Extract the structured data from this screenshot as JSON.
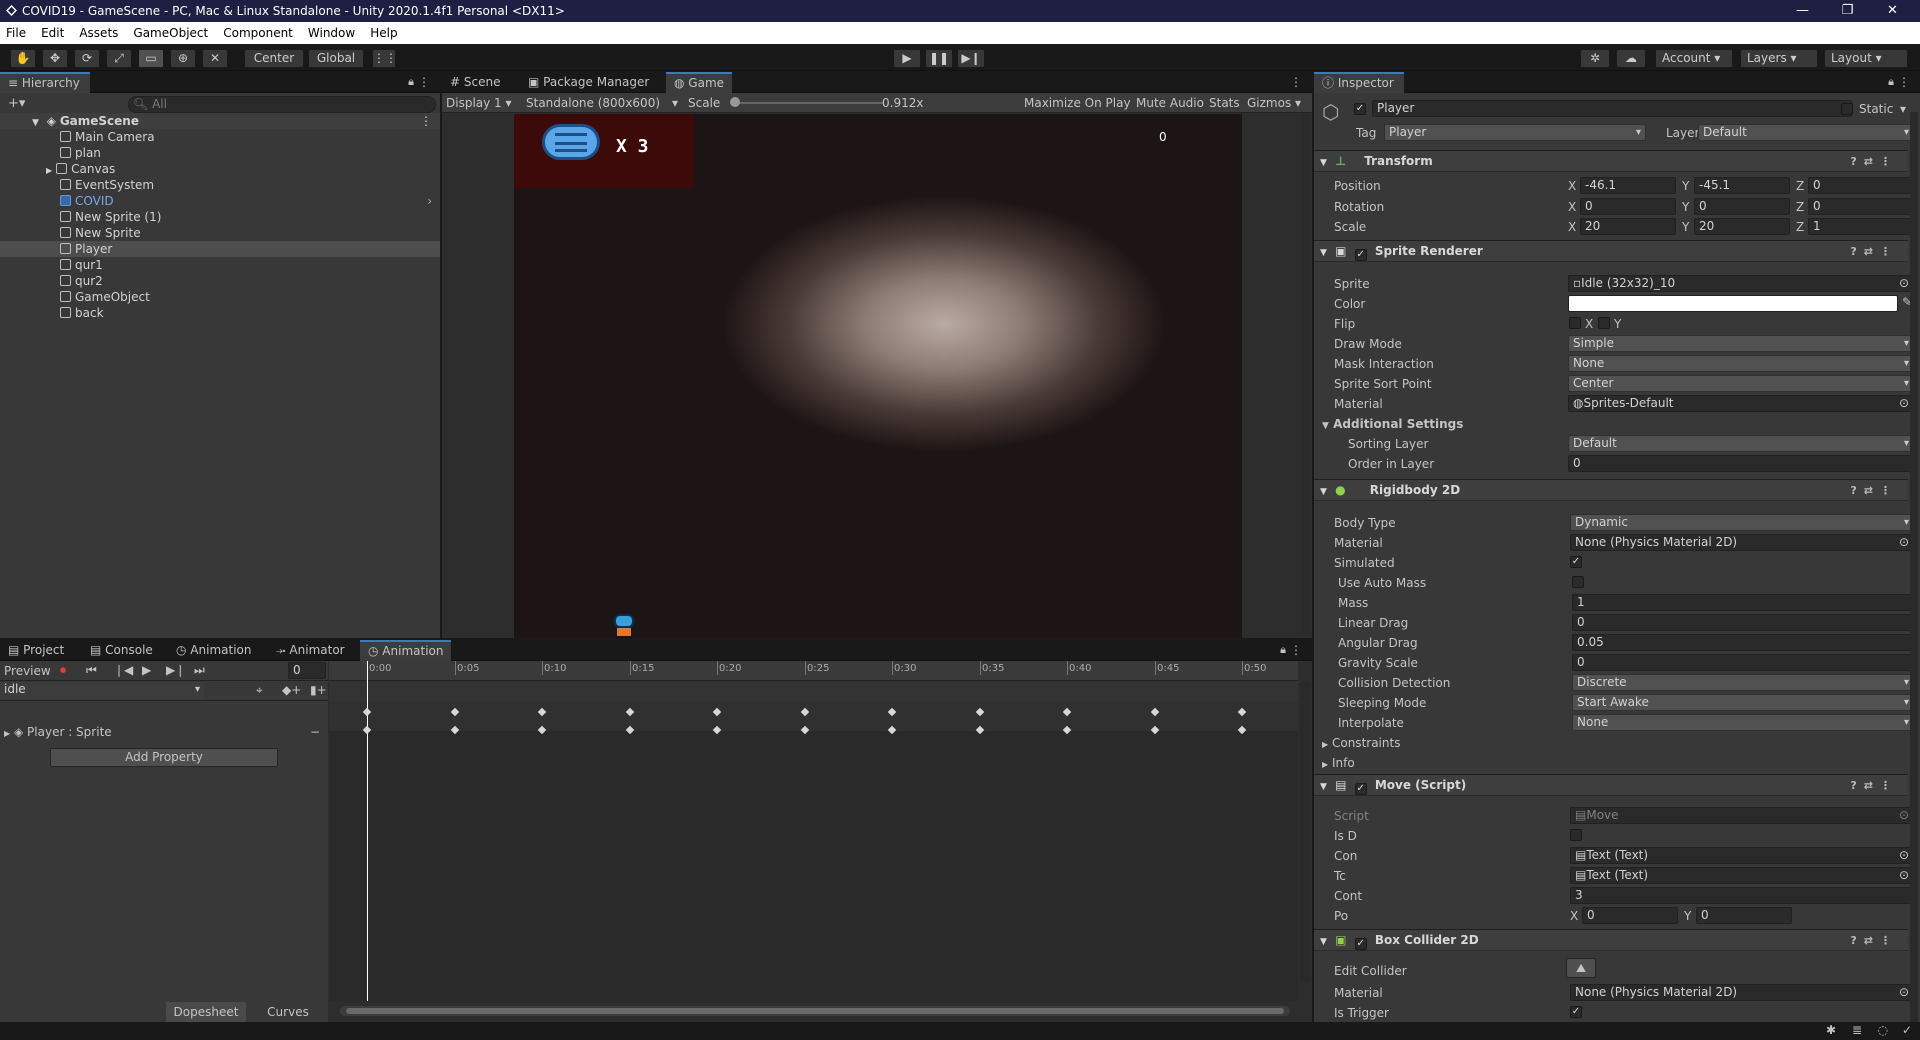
{
  "window": {
    "title": "COVID19 - GameScene - PC, Mac & Linux Standalone - Unity 2020.1.4f1 Personal <DX11>",
    "min": "—",
    "max": "❐",
    "close": "✕"
  },
  "menu": [
    "File",
    "Edit",
    "Assets",
    "GameObject",
    "Component",
    "Window",
    "Help"
  ],
  "toolbar": {
    "center": "Center",
    "global": "Global",
    "account": "Account",
    "layers": "Layers",
    "layout": "Layout"
  },
  "hierarchy": {
    "tab": "Hierarchy",
    "add": "+▾",
    "search_placeholder": "All",
    "scene": "GameScene",
    "items": [
      "Main Camera",
      "plan",
      "Canvas",
      "EventSystem",
      "COVID",
      "New Sprite (1)",
      "New Sprite",
      "Player",
      "qur1",
      "qur2",
      "GameObject",
      "back"
    ]
  },
  "viewtabs": {
    "scene": "Scene",
    "package": "Package Manager",
    "game": "Game"
  },
  "gamebar": {
    "display": "Display 1",
    "resolution": "Standalone (800x600)",
    "scale_label": "Scale",
    "scale_value": "0.912x",
    "maximize": "Maximize On Play",
    "mute": "Mute Audio",
    "stats": "Stats",
    "gizmos": "Gizmos"
  },
  "game": {
    "lives": "X 3",
    "score": "0"
  },
  "bottomtabs": {
    "project": "Project",
    "console": "Console",
    "animation1": "Animation",
    "animator": "Animator",
    "animation2": "Animation"
  },
  "anim": {
    "preview": "Preview",
    "frame": "0",
    "clip": "idle",
    "property": "Player : Sprite",
    "add_property": "Add Property",
    "dopesheet": "Dopesheet",
    "curves": "Curves",
    "ticks": [
      "0:00",
      "0:05",
      "0:10",
      "0:15",
      "0:20",
      "0:25",
      "0:30",
      "0:35",
      "0:40",
      "0:45",
      "0:50"
    ]
  },
  "inspector": {
    "tab": "Inspector",
    "name": "Player",
    "static": "Static",
    "tag_label": "Tag",
    "tag": "Player",
    "layer_label": "Layer",
    "layer": "Default",
    "transform": {
      "title": "Transform",
      "position": "Position",
      "rotation": "Rotation",
      "scale": "Scale",
      "pos": [
        "-46.1",
        "-45.1",
        "0"
      ],
      "rot": [
        "0",
        "0",
        "0"
      ],
      "scl": [
        "20",
        "20",
        "1"
      ]
    },
    "sprite_renderer": {
      "title": "Sprite Renderer",
      "sprite_l": "Sprite",
      "sprite": "Idle (32x32)_10",
      "color_l": "Color",
      "flip_l": "Flip",
      "flip_x": "X",
      "flip_y": "Y",
      "draw_mode_l": "Draw Mode",
      "draw_mode": "Simple",
      "mask_l": "Mask Interaction",
      "mask": "None",
      "sort_point_l": "Sprite Sort Point",
      "sort_point": "Center",
      "material_l": "Material",
      "material": "Sprites-Default",
      "additional": "Additional Settings",
      "sorting_layer_l": "Sorting Layer",
      "sorting_layer": "Default",
      "order_l": "Order in Layer",
      "order": "0"
    },
    "rigidbody": {
      "title": "Rigidbody 2D",
      "body_type_l": "Body Type",
      "body_type": "Dynamic",
      "material_l": "Material",
      "material": "None (Physics Material 2D)",
      "simulated_l": "Simulated",
      "auto_mass_l": "Use Auto Mass",
      "mass_l": "Mass",
      "mass": "1",
      "linear_l": "Linear Drag",
      "linear": "0",
      "angular_l": "Angular Drag",
      "angular": "0.05",
      "gravity_l": "Gravity Scale",
      "gravity": "0",
      "collision_l": "Collision Detection",
      "collision": "Discrete",
      "sleeping_l": "Sleeping Mode",
      "sleeping": "Start Awake",
      "interpolate_l": "Interpolate",
      "interpolate": "None",
      "constraints": "Constraints",
      "info": "Info"
    },
    "move": {
      "title": "Move (Script)",
      "script_l": "Script",
      "script": "Move",
      "isd_l": "Is D",
      "con_l": "Con",
      "con": "Text (Text)",
      "tc_l": "Tc",
      "tc": "Text (Text)",
      "cont_l": "Cont",
      "cont": "3",
      "po_l": "Po",
      "po_x": "0",
      "po_y": "0"
    },
    "box": {
      "title": "Box Collider 2D",
      "edit_l": "Edit Collider",
      "material_l": "Material",
      "material": "None (Physics Material 2D)",
      "trigger_l": "Is Trigger"
    }
  }
}
